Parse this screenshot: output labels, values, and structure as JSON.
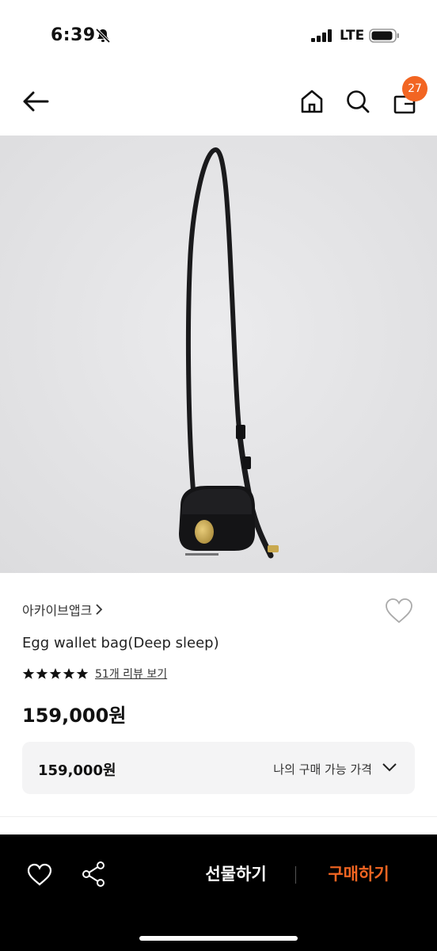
{
  "status_bar": {
    "time": "6:39",
    "network": "LTE"
  },
  "header": {
    "cart_count": "27"
  },
  "product": {
    "brand": "아카이브앱크",
    "name": "Egg wallet bag(Deep sleep)",
    "rating_stars": 5,
    "review_link": "51개 리뷰 보기",
    "price": "159,000원"
  },
  "price_box": {
    "amount": "159,000원",
    "label": "나의 구매 가능 가격"
  },
  "bottom_bar": {
    "gift_label": "선물하기",
    "buy_label": "구매하기"
  },
  "colors": {
    "accent": "#f26522",
    "bottom_bar_bg": "#000000",
    "image_bg": "#e4e4e6"
  }
}
